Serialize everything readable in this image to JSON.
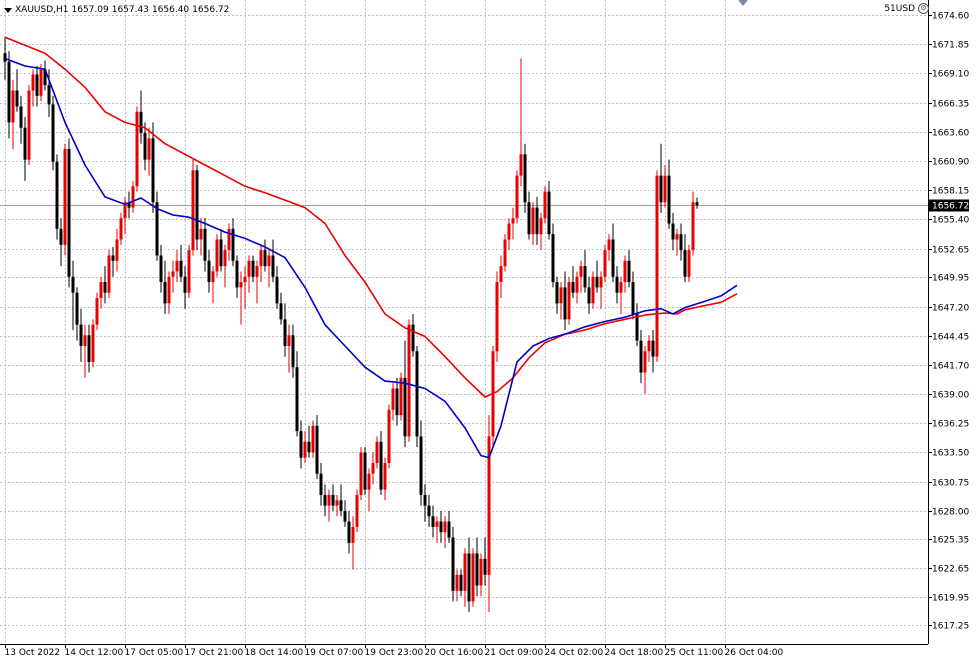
{
  "header": {
    "symbol": "XAUUSD,H1",
    "open": "1657.09",
    "high": "1657.43",
    "low": "1656.40",
    "close": "1656.72",
    "indicator_label": "51USD"
  },
  "colors": {
    "bull": "#e80000",
    "bear": "#000000",
    "ma_fast": "#0000cc",
    "ma_slow": "#ee0000",
    "grid": "#c0c0c0",
    "price_tag_bg": "#000000",
    "price_line": "#a0a0a0"
  },
  "chart_data": {
    "type": "candlestick",
    "y_axis_side": "right",
    "ylim": [
      1615.5,
      1676.0
    ],
    "y_ticks": [
      "1674.60",
      "1671.85",
      "1669.10",
      "1666.35",
      "1663.60",
      "1660.90",
      "1658.15",
      "1655.40",
      "1652.65",
      "1649.95",
      "1647.20",
      "1644.45",
      "1641.70",
      "1639.00",
      "1636.25",
      "1633.50",
      "1630.75",
      "1628.00",
      "1625.35",
      "1622.65",
      "1619.95",
      "1617.25"
    ],
    "x_labels": [
      {
        "label": "13 Oct 2022",
        "index": 0
      },
      {
        "label": "14 Oct 12:00",
        "index": 15
      },
      {
        "label": "17 Oct 05:00",
        "index": 30
      },
      {
        "label": "17 Oct 21:00",
        "index": 45
      },
      {
        "label": "18 Oct 14:00",
        "index": 60
      },
      {
        "label": "19 Oct 07:00",
        "index": 75
      },
      {
        "label": "19 Oct 23:00",
        "index": 90
      },
      {
        "label": "20 Oct 16:00",
        "index": 105
      },
      {
        "label": "21 Oct 09:00",
        "index": 120
      },
      {
        "label": "24 Oct 02:00",
        "index": 135
      },
      {
        "label": "24 Oct 18:00",
        "index": 150
      },
      {
        "label": "25 Oct 11:00",
        "index": 165
      },
      {
        "label": "26 Oct 04:00",
        "index": 180
      }
    ],
    "current_price": "1656.72",
    "candles": [
      [
        1671.0,
        1672.5,
        1668.5,
        1670.2
      ],
      [
        1670.2,
        1671.2,
        1663.0,
        1664.5
      ],
      [
        1664.5,
        1668.5,
        1662.0,
        1667.5
      ],
      [
        1667.5,
        1669.5,
        1665.5,
        1666.0
      ],
      [
        1666.0,
        1667.0,
        1662.5,
        1664.0
      ],
      [
        1664.0,
        1665.0,
        1659.0,
        1661.0
      ],
      [
        1661.0,
        1668.0,
        1660.5,
        1667.5
      ],
      [
        1667.5,
        1669.5,
        1666.0,
        1669.0
      ],
      [
        1669.0,
        1669.8,
        1666.0,
        1667.0
      ],
      [
        1667.0,
        1670.0,
        1666.5,
        1669.5
      ],
      [
        1669.5,
        1670.3,
        1667.5,
        1668.0
      ],
      [
        1668.0,
        1669.5,
        1665.0,
        1666.2
      ],
      [
        1666.2,
        1667.0,
        1660.0,
        1660.8
      ],
      [
        1660.8,
        1661.5,
        1653.5,
        1654.5
      ],
      [
        1654.5,
        1655.5,
        1651.0,
        1653.0
      ],
      [
        1653.0,
        1662.5,
        1652.0,
        1662.0
      ],
      [
        1662.0,
        1663.0,
        1649.0,
        1650.0
      ],
      [
        1650.0,
        1651.5,
        1645.0,
        1648.5
      ],
      [
        1648.5,
        1649.0,
        1644.0,
        1645.5
      ],
      [
        1645.5,
        1647.0,
        1642.0,
        1643.5
      ],
      [
        1643.5,
        1645.5,
        1640.5,
        1644.5
      ],
      [
        1644.5,
        1645.5,
        1641.0,
        1642.0
      ],
      [
        1642.0,
        1646.0,
        1641.5,
        1645.5
      ],
      [
        1645.5,
        1648.5,
        1645.0,
        1648.0
      ],
      [
        1648.0,
        1650.0,
        1647.0,
        1649.5
      ],
      [
        1649.5,
        1651.0,
        1647.5,
        1648.5
      ],
      [
        1648.5,
        1652.5,
        1648.0,
        1652.0
      ],
      [
        1652.0,
        1652.8,
        1650.0,
        1651.5
      ],
      [
        1651.5,
        1654.5,
        1650.5,
        1653.5
      ],
      [
        1653.5,
        1656.0,
        1653.0,
        1655.5
      ],
      [
        1655.5,
        1657.5,
        1654.0,
        1657.0
      ],
      [
        1657.0,
        1658.0,
        1655.5,
        1656.5
      ],
      [
        1656.5,
        1659.0,
        1656.0,
        1658.5
      ],
      [
        1658.5,
        1666.0,
        1658.0,
        1665.5
      ],
      [
        1665.5,
        1667.5,
        1662.5,
        1663.5
      ],
      [
        1663.5,
        1664.5,
        1660.0,
        1661.0
      ],
      [
        1661.0,
        1664.0,
        1659.5,
        1663.0
      ],
      [
        1663.0,
        1664.5,
        1656.0,
        1657.0
      ],
      [
        1657.0,
        1658.0,
        1651.5,
        1652.0
      ],
      [
        1652.0,
        1653.0,
        1648.5,
        1649.5
      ],
      [
        1649.5,
        1651.5,
        1646.5,
        1647.5
      ],
      [
        1647.5,
        1650.5,
        1646.5,
        1650.0
      ],
      [
        1650.0,
        1651.5,
        1648.5,
        1650.5
      ],
      [
        1650.5,
        1652.5,
        1649.5,
        1651.5
      ],
      [
        1651.5,
        1653.0,
        1649.5,
        1650.0
      ],
      [
        1650.0,
        1651.0,
        1647.0,
        1648.5
      ],
      [
        1648.5,
        1653.0,
        1648.0,
        1652.5
      ],
      [
        1652.5,
        1661.0,
        1652.0,
        1660.0
      ],
      [
        1660.0,
        1660.5,
        1652.5,
        1653.5
      ],
      [
        1653.5,
        1655.5,
        1652.0,
        1654.5
      ],
      [
        1654.5,
        1655.5,
        1650.5,
        1651.5
      ],
      [
        1651.5,
        1652.5,
        1648.5,
        1649.5
      ],
      [
        1649.5,
        1651.0,
        1647.5,
        1650.5
      ],
      [
        1650.5,
        1654.0,
        1650.0,
        1653.5
      ],
      [
        1653.5,
        1654.5,
        1650.5,
        1651.0
      ],
      [
        1651.0,
        1653.0,
        1649.0,
        1652.5
      ],
      [
        1652.5,
        1655.0,
        1651.5,
        1654.5
      ],
      [
        1654.5,
        1655.5,
        1651.0,
        1651.5
      ],
      [
        1651.5,
        1652.0,
        1648.0,
        1649.0
      ],
      [
        1649.0,
        1650.5,
        1645.5,
        1649.5
      ],
      [
        1649.5,
        1651.0,
        1647.0,
        1650.0
      ],
      [
        1650.0,
        1652.0,
        1648.5,
        1651.5
      ],
      [
        1651.5,
        1652.0,
        1649.5,
        1650.0
      ],
      [
        1650.0,
        1651.5,
        1647.5,
        1651.0
      ],
      [
        1651.0,
        1653.0,
        1649.5,
        1652.5
      ],
      [
        1652.5,
        1653.5,
        1650.5,
        1651.0
      ],
      [
        1651.0,
        1652.5,
        1649.0,
        1652.0
      ],
      [
        1652.0,
        1653.5,
        1649.5,
        1650.0
      ],
      [
        1650.0,
        1651.0,
        1647.0,
        1647.5
      ],
      [
        1647.5,
        1648.5,
        1645.5,
        1646.0
      ],
      [
        1646.0,
        1647.5,
        1642.5,
        1643.5
      ],
      [
        1643.5,
        1645.5,
        1641.0,
        1644.5
      ],
      [
        1644.5,
        1645.5,
        1640.5,
        1641.5
      ],
      [
        1641.5,
        1643.0,
        1635.0,
        1635.5
      ],
      [
        1635.5,
        1636.5,
        1632.0,
        1633.0
      ],
      [
        1633.0,
        1635.5,
        1632.5,
        1634.5
      ],
      [
        1634.5,
        1636.0,
        1633.0,
        1633.5
      ],
      [
        1633.5,
        1636.5,
        1633.0,
        1636.0
      ],
      [
        1636.0,
        1637.0,
        1631.0,
        1631.5
      ],
      [
        1631.5,
        1632.5,
        1628.5,
        1629.5
      ],
      [
        1629.5,
        1630.5,
        1627.5,
        1628.5
      ],
      [
        1628.5,
        1630.0,
        1627.0,
        1629.5
      ],
      [
        1629.5,
        1630.5,
        1628.0,
        1628.5
      ],
      [
        1628.5,
        1629.5,
        1627.5,
        1629.0
      ],
      [
        1629.0,
        1630.5,
        1627.5,
        1628.0
      ],
      [
        1628.0,
        1629.0,
        1626.5,
        1627.0
      ],
      [
        1627.0,
        1628.0,
        1624.0,
        1625.0
      ],
      [
        1625.0,
        1627.5,
        1622.5,
        1626.5
      ],
      [
        1626.5,
        1630.0,
        1626.0,
        1629.5
      ],
      [
        1629.5,
        1634.0,
        1629.0,
        1633.5
      ],
      [
        1633.5,
        1634.0,
        1629.5,
        1630.0
      ],
      [
        1630.0,
        1632.0,
        1628.0,
        1631.5
      ],
      [
        1631.5,
        1633.5,
        1630.5,
        1632.5
      ],
      [
        1632.5,
        1635.0,
        1632.0,
        1634.5
      ],
      [
        1634.5,
        1635.5,
        1629.5,
        1630.0
      ],
      [
        1630.0,
        1633.0,
        1629.0,
        1632.5
      ],
      [
        1632.5,
        1638.0,
        1632.0,
        1637.5
      ],
      [
        1637.5,
        1640.0,
        1636.5,
        1639.5
      ],
      [
        1639.5,
        1640.5,
        1636.0,
        1637.0
      ],
      [
        1637.0,
        1641.0,
        1636.5,
        1640.5
      ],
      [
        1640.5,
        1644.0,
        1634.0,
        1635.0
      ],
      [
        1635.0,
        1646.0,
        1634.5,
        1645.5
      ],
      [
        1645.5,
        1646.5,
        1642.5,
        1643.0
      ],
      [
        1643.0,
        1643.5,
        1634.0,
        1635.0
      ],
      [
        1635.0,
        1636.5,
        1628.5,
        1629.5
      ],
      [
        1629.5,
        1630.5,
        1627.0,
        1628.5
      ],
      [
        1628.5,
        1629.5,
        1626.5,
        1627.5
      ],
      [
        1627.5,
        1628.5,
        1625.5,
        1626.5
      ],
      [
        1626.5,
        1627.5,
        1625.0,
        1627.0
      ],
      [
        1627.0,
        1628.0,
        1625.0,
        1626.0
      ],
      [
        1626.0,
        1627.5,
        1624.5,
        1627.0
      ],
      [
        1627.0,
        1628.0,
        1625.0,
        1625.5
      ],
      [
        1625.5,
        1626.5,
        1619.5,
        1620.5
      ],
      [
        1620.5,
        1622.5,
        1619.5,
        1622.0
      ],
      [
        1622.0,
        1622.5,
        1620.0,
        1620.5
      ],
      [
        1620.5,
        1624.5,
        1619.0,
        1624.0
      ],
      [
        1624.0,
        1625.5,
        1618.5,
        1619.5
      ],
      [
        1619.5,
        1624.5,
        1619.0,
        1624.0
      ],
      [
        1624.0,
        1625.5,
        1620.0,
        1621.0
      ],
      [
        1621.0,
        1624.0,
        1620.0,
        1623.5
      ],
      [
        1623.5,
        1625.5,
        1621.0,
        1622.0
      ],
      [
        1622.0,
        1637.0,
        1618.5,
        1635.0
      ],
      [
        1635.0,
        1643.5,
        1634.0,
        1643.0
      ],
      [
        1643.0,
        1650.5,
        1642.0,
        1649.5
      ],
      [
        1649.5,
        1652.0,
        1648.0,
        1651.0
      ],
      [
        1651.0,
        1654.0,
        1650.5,
        1653.5
      ],
      [
        1653.5,
        1655.5,
        1652.5,
        1655.0
      ],
      [
        1655.0,
        1656.5,
        1653.5,
        1655.5
      ],
      [
        1655.5,
        1660.0,
        1655.0,
        1659.5
      ],
      [
        1659.5,
        1670.5,
        1658.5,
        1661.5
      ],
      [
        1661.5,
        1662.5,
        1656.0,
        1657.0
      ],
      [
        1657.0,
        1658.0,
        1653.5,
        1654.0
      ],
      [
        1654.0,
        1657.0,
        1653.0,
        1656.5
      ],
      [
        1656.5,
        1657.5,
        1653.0,
        1654.0
      ],
      [
        1654.0,
        1656.0,
        1652.5,
        1655.5
      ],
      [
        1655.5,
        1658.5,
        1655.0,
        1658.0
      ],
      [
        1658.0,
        1659.0,
        1653.5,
        1654.0
      ],
      [
        1654.0,
        1655.0,
        1649.0,
        1649.5
      ],
      [
        1649.5,
        1650.0,
        1646.5,
        1647.5
      ],
      [
        1647.5,
        1649.5,
        1646.0,
        1649.0
      ],
      [
        1649.0,
        1650.5,
        1645.0,
        1646.0
      ],
      [
        1646.0,
        1650.0,
        1645.5,
        1649.5
      ],
      [
        1649.5,
        1651.0,
        1648.0,
        1648.5
      ],
      [
        1648.5,
        1650.5,
        1647.5,
        1650.0
      ],
      [
        1650.0,
        1651.5,
        1648.5,
        1651.0
      ],
      [
        1651.0,
        1652.5,
        1648.5,
        1649.0
      ],
      [
        1649.0,
        1650.0,
        1646.5,
        1647.5
      ],
      [
        1647.5,
        1650.5,
        1647.0,
        1650.0
      ],
      [
        1650.0,
        1651.5,
        1648.5,
        1649.0
      ],
      [
        1649.0,
        1650.5,
        1647.0,
        1650.0
      ],
      [
        1650.0,
        1653.0,
        1649.5,
        1652.5
      ],
      [
        1652.5,
        1654.0,
        1651.5,
        1653.5
      ],
      [
        1653.5,
        1655.0,
        1649.5,
        1650.0
      ],
      [
        1650.0,
        1651.0,
        1647.5,
        1648.5
      ],
      [
        1648.5,
        1650.0,
        1646.5,
        1649.5
      ],
      [
        1649.5,
        1652.0,
        1648.5,
        1651.5
      ],
      [
        1651.5,
        1652.5,
        1649.0,
        1649.5
      ],
      [
        1649.5,
        1650.5,
        1646.0,
        1646.5
      ],
      [
        1646.5,
        1647.5,
        1643.5,
        1644.0
      ],
      [
        1644.0,
        1645.0,
        1640.0,
        1641.0
      ],
      [
        1641.0,
        1643.5,
        1639.0,
        1643.0
      ],
      [
        1643.0,
        1644.5,
        1642.0,
        1644.0
      ],
      [
        1644.0,
        1645.0,
        1641.0,
        1642.5
      ],
      [
        1642.5,
        1660.0,
        1642.0,
        1659.5
      ],
      [
        1659.5,
        1662.5,
        1656.0,
        1657.0
      ],
      [
        1657.0,
        1660.5,
        1656.5,
        1659.5
      ],
      [
        1659.5,
        1661.0,
        1654.5,
        1655.0
      ],
      [
        1655.0,
        1656.0,
        1652.5,
        1653.5
      ],
      [
        1653.5,
        1654.5,
        1652.0,
        1654.0
      ],
      [
        1654.0,
        1655.0,
        1651.5,
        1652.5
      ],
      [
        1652.5,
        1654.0,
        1649.5,
        1650.0
      ],
      [
        1650.0,
        1653.0,
        1649.5,
        1652.5
      ],
      [
        1652.5,
        1658.0,
        1652.0,
        1657.0
      ],
      [
        1657.0,
        1657.43,
        1656.4,
        1656.72
      ]
    ],
    "ma_fast": [
      [
        0,
        1670.5
      ],
      [
        5,
        1669.8
      ],
      [
        10,
        1669.5
      ],
      [
        15,
        1664.5
      ],
      [
        20,
        1660.5
      ],
      [
        25,
        1657.5
      ],
      [
        30,
        1656.8
      ],
      [
        34,
        1657.4
      ],
      [
        38,
        1656.4
      ],
      [
        42,
        1655.8
      ],
      [
        46,
        1655.6
      ],
      [
        50,
        1655.0
      ],
      [
        55,
        1654.2
      ],
      [
        60,
        1653.6
      ],
      [
        65,
        1652.8
      ],
      [
        70,
        1651.8
      ],
      [
        75,
        1649.0
      ],
      [
        80,
        1645.5
      ],
      [
        85,
        1643.5
      ],
      [
        90,
        1641.5
      ],
      [
        95,
        1640.2
      ],
      [
        100,
        1640.0
      ],
      [
        105,
        1639.5
      ],
      [
        110,
        1638.3
      ],
      [
        115,
        1635.8
      ],
      [
        119,
        1633.2
      ],
      [
        121,
        1633.0
      ],
      [
        124,
        1636.0
      ],
      [
        128,
        1642.0
      ],
      [
        132,
        1643.5
      ],
      [
        136,
        1644.2
      ],
      [
        140,
        1644.6
      ],
      [
        145,
        1645.3
      ],
      [
        150,
        1645.8
      ],
      [
        155,
        1646.2
      ],
      [
        160,
        1646.8
      ],
      [
        164,
        1647.0
      ],
      [
        167,
        1646.5
      ],
      [
        170,
        1647.1
      ],
      [
        175,
        1647.7
      ],
      [
        179,
        1648.2
      ],
      [
        183,
        1649.2
      ]
    ],
    "ma_slow": [
      [
        0,
        1672.5
      ],
      [
        10,
        1671.0
      ],
      [
        15,
        1669.5
      ],
      [
        20,
        1667.8
      ],
      [
        25,
        1665.5
      ],
      [
        30,
        1664.5
      ],
      [
        35,
        1664.0
      ],
      [
        40,
        1662.5
      ],
      [
        45,
        1661.5
      ],
      [
        50,
        1660.5
      ],
      [
        55,
        1659.5
      ],
      [
        60,
        1658.5
      ],
      [
        65,
        1657.9
      ],
      [
        70,
        1657.2
      ],
      [
        75,
        1656.5
      ],
      [
        80,
        1655.0
      ],
      [
        85,
        1652.0
      ],
      [
        90,
        1649.5
      ],
      [
        95,
        1646.5
      ],
      [
        100,
        1645.2
      ],
      [
        105,
        1644.4
      ],
      [
        110,
        1642.5
      ],
      [
        115,
        1640.5
      ],
      [
        120,
        1638.7
      ],
      [
        123,
        1639.2
      ],
      [
        127,
        1640.5
      ],
      [
        131,
        1642.4
      ],
      [
        135,
        1643.8
      ],
      [
        140,
        1644.6
      ],
      [
        145,
        1645.0
      ],
      [
        150,
        1645.6
      ],
      [
        155,
        1646.0
      ],
      [
        160,
        1646.4
      ],
      [
        165,
        1646.6
      ],
      [
        168,
        1646.5
      ],
      [
        170,
        1646.9
      ],
      [
        175,
        1647.3
      ],
      [
        179,
        1647.6
      ],
      [
        183,
        1648.4
      ]
    ]
  }
}
